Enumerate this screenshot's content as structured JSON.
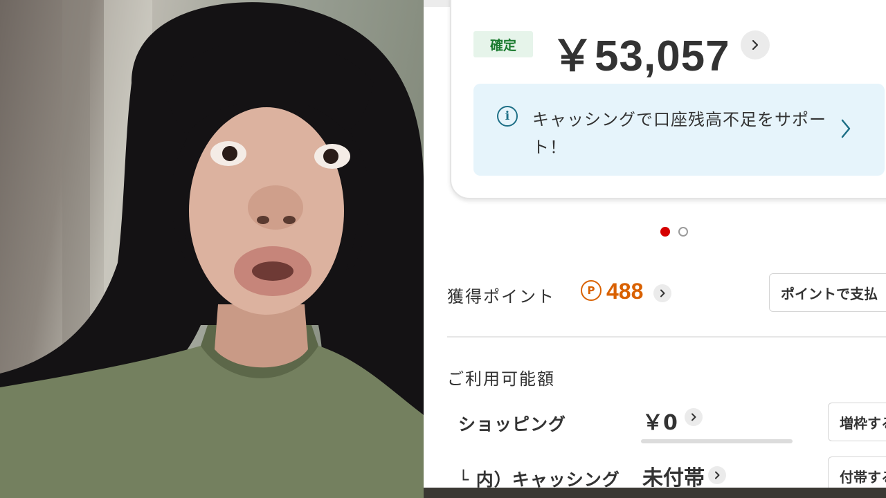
{
  "bill": {
    "status_badge": "確定",
    "amount": "￥53,057"
  },
  "info_banner": {
    "icon": "i",
    "text": "キャッシングで口座残高不足をサポート！"
  },
  "carousel": {
    "total": 2,
    "active_index": 0
  },
  "points": {
    "label": "獲得ポイント",
    "icon": "P",
    "value": "488",
    "button": "ポイントで支払"
  },
  "available": {
    "section_title": "ご利用可能額",
    "shopping": {
      "label": "ショッピング",
      "value": "￥0",
      "progress": 0.0,
      "button": "増枠する"
    },
    "cashing": {
      "label": "└ 内）キャッシング",
      "value": "未付帯",
      "button": "付帯する"
    }
  },
  "colors": {
    "accent_red": "#d50000",
    "points_orange": "#d96100",
    "badge_green": "#1a7a2e",
    "banner_blue": "#e6f4fb"
  }
}
